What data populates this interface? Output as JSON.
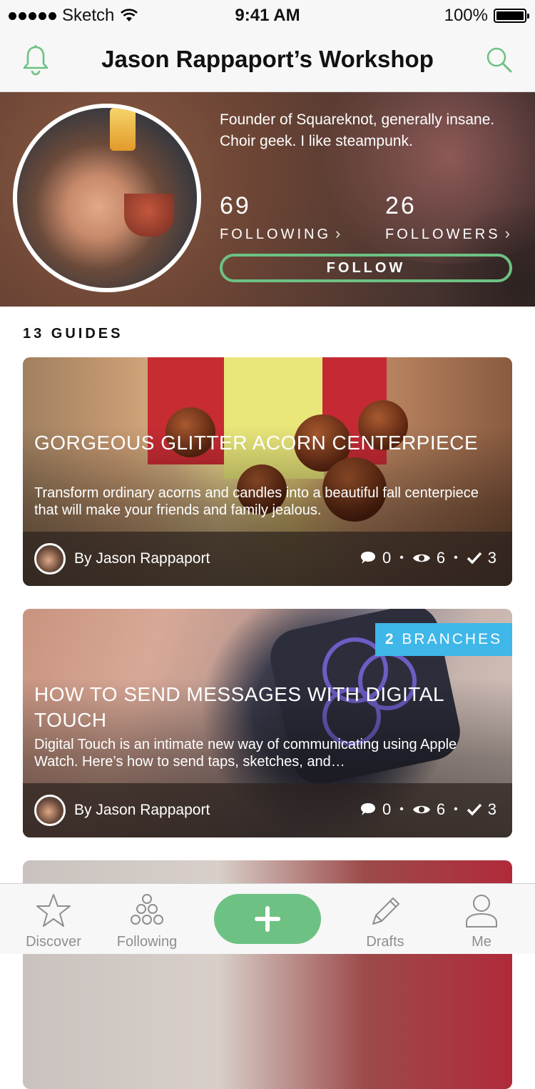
{
  "status_bar": {
    "carrier": "Sketch",
    "time": "9:41 AM",
    "battery": "100%",
    "battery_level": 1.0
  },
  "nav": {
    "title": "Jason Rappaport’s Workshop",
    "left_icon": "bell-icon",
    "right_icon": "search-icon"
  },
  "profile": {
    "bio": "Founder of Squareknot, generally insane. Choir geek. I like steampunk.",
    "following_count": "69",
    "following_label": "FOLLOWING",
    "followers_count": "26",
    "followers_label": "FOLLOWERS",
    "follow_button": "FOLLOW"
  },
  "guides": {
    "section_title": "13 GUIDES",
    "cards": [
      {
        "title": "GORGEOUS GLITTER ACORN CENTERPIECE",
        "description": "Transform ordinary acorns and candles into a beautiful fall centerpiece that will make your friends and family jealous.",
        "author": "By Jason Rappaport",
        "comments": "0",
        "views": "6",
        "completions": "3"
      },
      {
        "badge_count": "2",
        "badge_label": "BRANCHES",
        "title": "HOW TO SEND MESSAGES WITH DIGITAL TOUCH",
        "description": "Digital Touch is an intimate new way of communicating using Apple Watch. Here’s how to send taps, sketches, and…",
        "author": "By Jason Rappaport",
        "comments": "0",
        "views": "6",
        "completions": "3"
      }
    ]
  },
  "tabbar": {
    "discover": "Discover",
    "following": "Following",
    "drafts": "Drafts",
    "me": "Me"
  },
  "colors": {
    "accent_green": "#6dc283",
    "badge_blue": "#3fb7e8",
    "tab_gray": "#8e8e93"
  }
}
